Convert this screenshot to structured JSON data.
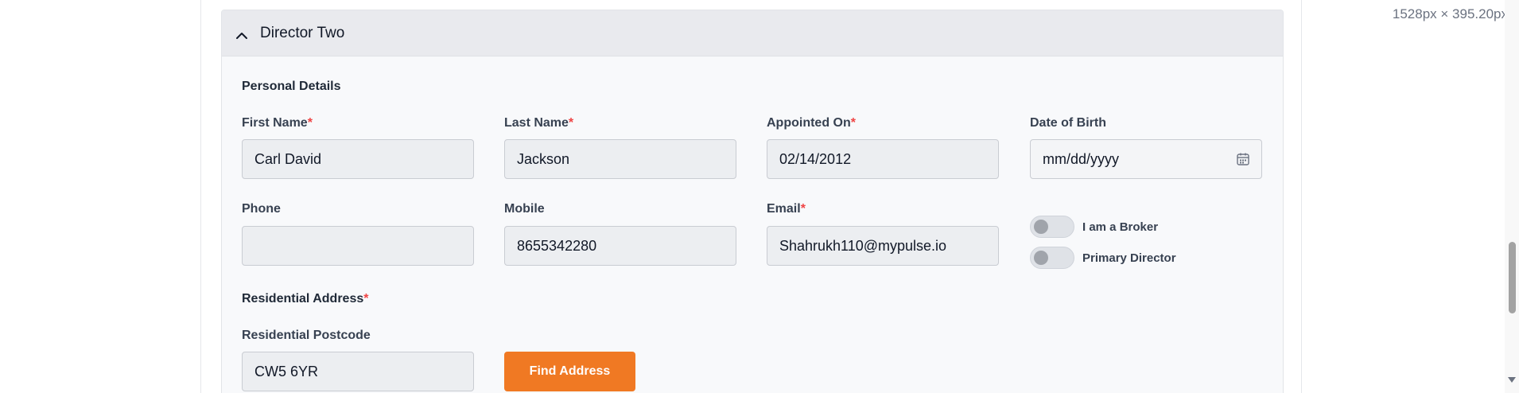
{
  "viewport_readout": "1528px × 395.20px",
  "section": {
    "title": "Director Two",
    "personal_details_label": "Personal Details",
    "residential_address_label": "Residential Address",
    "residential_address_required": "*"
  },
  "fields": {
    "first_name": {
      "label": "First Name",
      "required": "*",
      "value": "Carl David"
    },
    "last_name": {
      "label": "Last Name",
      "required": "*",
      "value": "Jackson"
    },
    "appointed_on": {
      "label": "Appointed On",
      "required": "*",
      "value": "02/14/2012"
    },
    "date_of_birth": {
      "label": "Date of Birth",
      "value": "mm/dd/yyyy"
    },
    "phone": {
      "label": "Phone",
      "value": ""
    },
    "mobile": {
      "label": "Mobile",
      "value": "8655342280"
    },
    "email": {
      "label": "Email",
      "required": "*",
      "value": "Shahrukh110@mypulse.io"
    },
    "residential_postcode": {
      "label": "Residential Postcode",
      "value": "CW5 6YR"
    }
  },
  "toggles": {
    "broker": {
      "label": "I am a Broker",
      "on": false
    },
    "primary_director": {
      "label": "Primary Director",
      "on": false
    }
  },
  "buttons": {
    "find_address": "Find Address"
  },
  "icons": {
    "collapse": "chevron-up-icon",
    "calendar": "calendar-icon"
  },
  "colors": {
    "accent": "#f07923",
    "required": "#ef4444",
    "header_bg": "#e9eaee"
  }
}
